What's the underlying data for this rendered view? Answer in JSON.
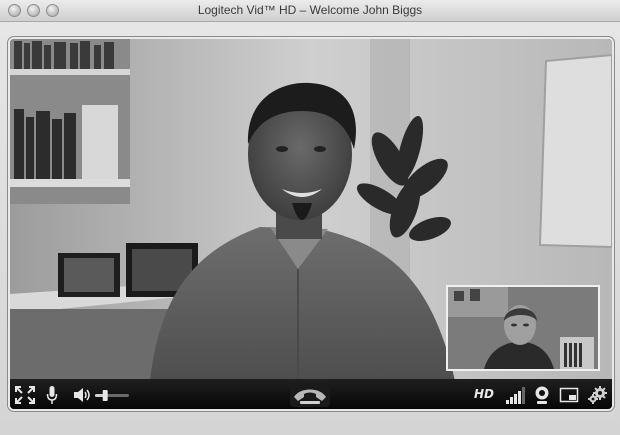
{
  "window": {
    "title": "Logitech Vid™ HD – Welcome John Biggs",
    "controls": [
      "close-icon",
      "minimize-icon",
      "zoom-icon"
    ]
  },
  "call": {
    "state": "in-call",
    "main_video": "remote participant",
    "self_view": "local camera"
  },
  "toolbar": {
    "hd_label": "HD",
    "volume_level": 0.3,
    "signal_bars_lit": 4,
    "icons": {
      "fullscreen": "fullscreen-icon",
      "mic": "microphone-icon",
      "speaker": "speaker-icon",
      "hangup": "hang-up-icon",
      "signal": "signal-strength-icon",
      "camera": "webcam-icon",
      "pip": "picture-in-picture-icon",
      "settings": "settings-gears-icon"
    }
  },
  "colors": {
    "toolbar_bg": "#0a0a0a",
    "icon_fg": "#e6e6e6",
    "frame_border": "#e9e9e9"
  }
}
